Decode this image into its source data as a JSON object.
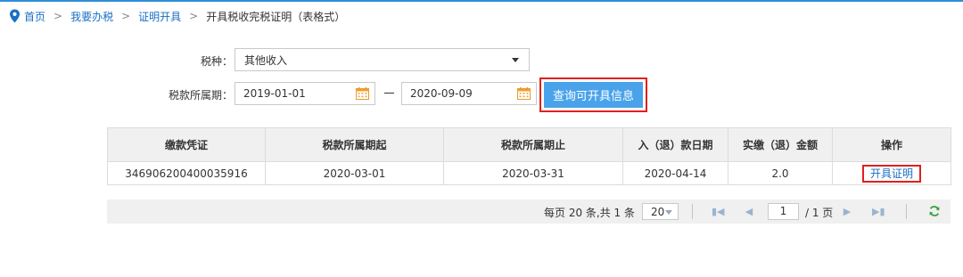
{
  "breadcrumb": {
    "items": [
      "首页",
      "我要办税",
      "证明开具"
    ],
    "current": "开具税收完税证明（表格式）",
    "separator": ">"
  },
  "form": {
    "tax_type_label": "税种：",
    "tax_type_value": "其他收入",
    "period_label": "税款所属期：",
    "date_from": "2019-01-01",
    "date_to": "2020-09-09",
    "query_button": "查询可开具信息"
  },
  "table": {
    "headers": [
      "缴款凭证",
      "税款所属期起",
      "税款所属期止",
      "入（退）款日期",
      "实缴（退）金额",
      "操作"
    ],
    "rows": [
      {
        "voucher": "346906200400035916",
        "period_start": "2020-03-01",
        "period_end": "2020-03-31",
        "pay_date": "2020-04-14",
        "amount": "2.0",
        "action": "开具证明"
      }
    ]
  },
  "pager": {
    "summary": "每页 20 条,共 1 条",
    "page_size": "20",
    "current_page": "1",
    "total_pages_text": "/ 1 页"
  },
  "colors": {
    "link": "#1a6fc4",
    "button": "#4aa3ea",
    "highlight": "#e02020",
    "calendar": "#f0a030",
    "refresh": "#3aa040"
  },
  "icons": [
    "location-pin-icon",
    "calendar-icon",
    "first-page-icon",
    "prev-page-icon",
    "next-page-icon",
    "last-page-icon",
    "refresh-icon"
  ]
}
